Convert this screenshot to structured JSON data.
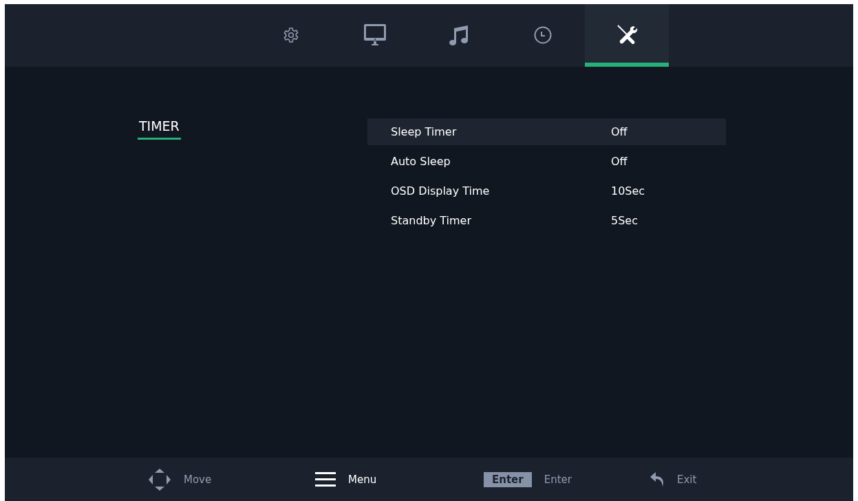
{
  "tabs": [
    {
      "kind": "gear",
      "selected": false
    },
    {
      "kind": "monitor",
      "selected": false
    },
    {
      "kind": "music",
      "selected": false
    },
    {
      "kind": "clock",
      "selected": false
    },
    {
      "kind": "tools",
      "selected": true
    }
  ],
  "section": {
    "title": "TIMER"
  },
  "settings": [
    {
      "label": "Sleep Timer",
      "value": "Off",
      "selected": true
    },
    {
      "label": "Auto Sleep",
      "value": "Off",
      "selected": false
    },
    {
      "label": "OSD Display Time",
      "value": "10Sec",
      "selected": false
    },
    {
      "label": "Standby Timer",
      "value": "5Sec",
      "selected": false
    }
  ],
  "hints": [
    {
      "kind": "move",
      "label": "Move",
      "bright": false
    },
    {
      "kind": "menu",
      "label": "Menu",
      "bright": true
    },
    {
      "kind": "key",
      "key": "Enter",
      "label": "Enter",
      "bright": false
    },
    {
      "kind": "back",
      "label": "Exit",
      "bright": false
    }
  ]
}
